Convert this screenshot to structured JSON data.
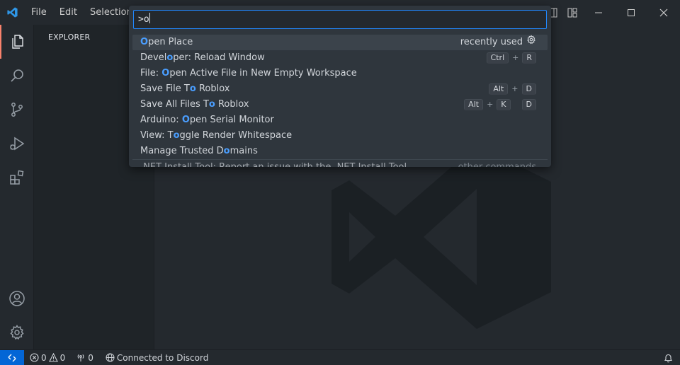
{
  "titlebar": {
    "menu": [
      "File",
      "Edit",
      "Selection"
    ]
  },
  "sidebar": {
    "title": "EXPLORER"
  },
  "palette": {
    "query": ">o",
    "items": [
      {
        "segs": [
          {
            "t": "O",
            "h": true
          },
          {
            "t": "pen Place",
            "h": false
          }
        ],
        "right": "recently used",
        "keys": []
      },
      {
        "segs": [
          {
            "t": "Devel",
            "h": false
          },
          {
            "t": "o",
            "h": true
          },
          {
            "t": "per: Reload Window",
            "h": false
          }
        ],
        "keys": [
          "Ctrl",
          "R"
        ]
      },
      {
        "segs": [
          {
            "t": "File: ",
            "h": false
          },
          {
            "t": "O",
            "h": true
          },
          {
            "t": "pen Active File in New Empty Workspace",
            "h": false
          }
        ],
        "keys": []
      },
      {
        "segs": [
          {
            "t": "Save File T",
            "h": false
          },
          {
            "t": "o",
            "h": true
          },
          {
            "t": " Roblox",
            "h": false
          }
        ],
        "keys": [
          "Alt",
          "D"
        ]
      },
      {
        "segs": [
          {
            "t": "Save All Files T",
            "h": false
          },
          {
            "t": "o",
            "h": true
          },
          {
            "t": " Roblox",
            "h": false
          }
        ],
        "keys": [
          "Alt",
          "K",
          "D"
        ]
      },
      {
        "segs": [
          {
            "t": "Arduino: ",
            "h": false
          },
          {
            "t": "O",
            "h": true
          },
          {
            "t": "pen Serial Monitor",
            "h": false
          }
        ],
        "keys": []
      },
      {
        "segs": [
          {
            "t": "View: T",
            "h": false
          },
          {
            "t": "o",
            "h": true
          },
          {
            "t": "ggle Render Whitespace",
            "h": false
          }
        ],
        "keys": []
      },
      {
        "segs": [
          {
            "t": "Manage Trusted D",
            "h": false
          },
          {
            "t": "o",
            "h": true
          },
          {
            "t": "mains",
            "h": false
          }
        ],
        "keys": []
      },
      {
        "segs": [
          {
            "t": ".NET Install Tool: Report an issue with the .NET Install Tool",
            "h": false
          }
        ],
        "right_label": "other commands",
        "keys": []
      }
    ]
  },
  "statusbar": {
    "errors": "0",
    "warnings": "0",
    "ports": "0",
    "discord": "Connected to Discord"
  },
  "colors": {
    "accent": "#2188ff",
    "highlight": "#4a9eff",
    "remote": "#0366d6"
  }
}
